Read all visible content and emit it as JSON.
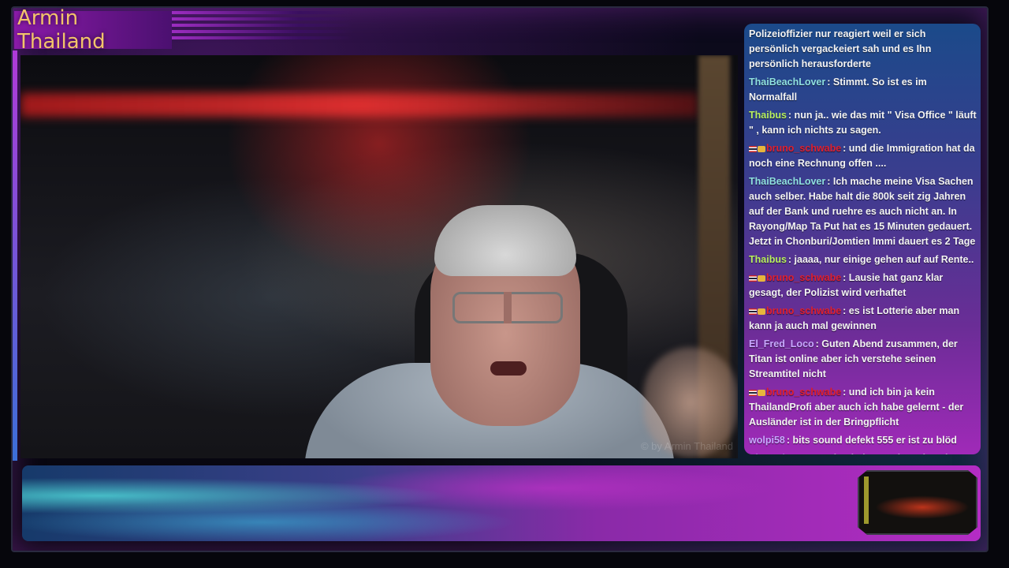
{
  "stream": {
    "title": "Armin Thailand",
    "watermark": "© by Armin Thailand"
  },
  "chat": {
    "messages": [
      {
        "user": "",
        "text": "Polizeioffizier nur reagiert weil er sich persönlich vergackeiert sah und es Ihn persönlich herausforderte",
        "color": "#ffffff",
        "badges": false
      },
      {
        "user": "ThaiBeachLover",
        "text": ": Stimmt. So ist es im Normalfall",
        "color": "#8fe0e0",
        "badges": false
      },
      {
        "user": "Thaibus",
        "text": ": nun ja.. wie das mit \" Visa Office \" läuft \" , kann ich nichts zu sagen.",
        "color": "#b8f060",
        "badges": false
      },
      {
        "user": "bruno_schwabe",
        "text": ": und die Immigration hat da noch eine Rechnung offen ....",
        "color": "#e02030",
        "badges": true
      },
      {
        "user": "ThaiBeachLover",
        "text": ": Ich mache meine Visa Sachen auch selber. Habe halt die 800k seit zig Jahren auf der Bank und ruehre es auch nicht an. In Rayong/Map Ta Put hat es 15 Minuten gedauert. Jetzt in Chonburi/Jomtien Immi dauert es 2 Tage",
        "color": "#8fe0e0",
        "badges": false
      },
      {
        "user": "Thaibus",
        "text": ": jaaaa, nur einige gehen auf auf Rente..",
        "color": "#b8f060",
        "badges": false
      },
      {
        "user": "bruno_schwabe",
        "text": ": Lausie hat ganz klar gesagt, der Polizist wird verhaftet",
        "color": "#e02030",
        "badges": true
      },
      {
        "user": "bruno_schwabe",
        "text": ": es ist Lotterie aber man kann ja auch mal gewinnen",
        "color": "#e02030",
        "badges": true
      },
      {
        "user": "El_Fred_Loco",
        "text": ": Guten Abend zusammen, der Titan ist online aber ich verstehe seinen Streamtitel nicht",
        "color": "#c8a8ff",
        "badges": false
      },
      {
        "user": "bruno_schwabe",
        "text": ": und ich bin ja kein ThailandProfi aber auch ich habe gelernt - der Ausländer ist in der Bringpflicht",
        "color": "#e02030",
        "badges": true
      },
      {
        "user": "wolpi58",
        "text": ": bits sound defekt 555 er ist zu blöd",
        "color": "#c8a8ff",
        "badges": false
      },
      {
        "user": "El_Fred_Loco",
        "text": ": Sein Titel: zurück zu den alten Roules hääääa?",
        "color": "#c8a8ff",
        "badges": false
      }
    ]
  }
}
